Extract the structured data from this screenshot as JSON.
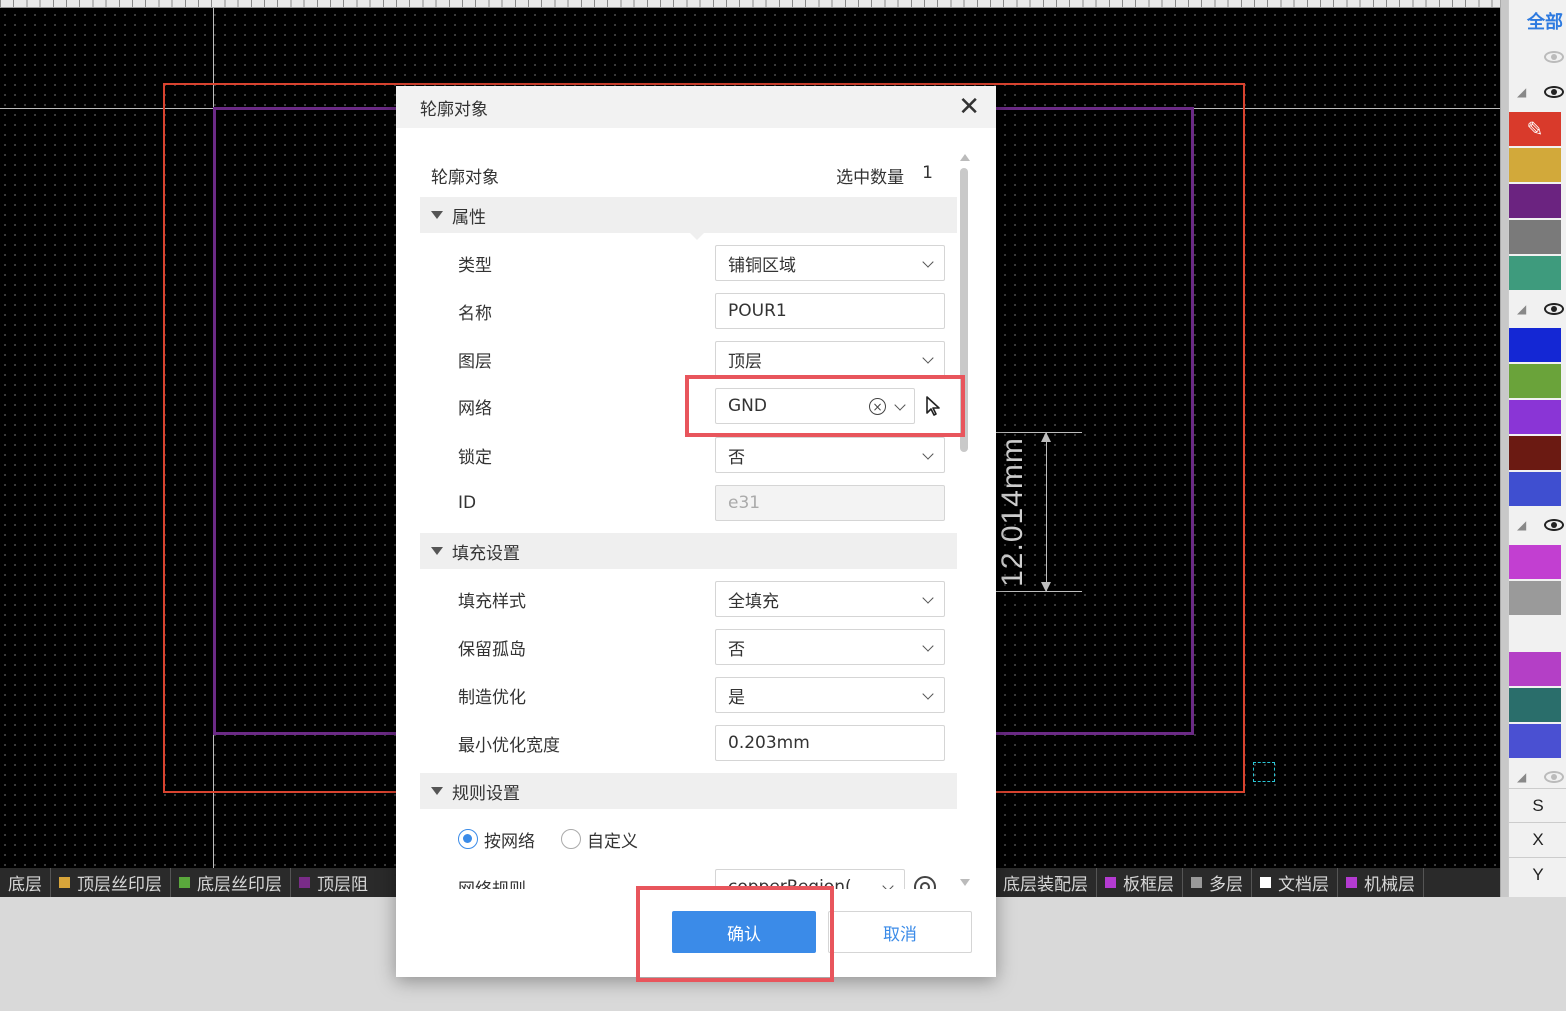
{
  "canvas": {
    "dimension_label": "12.014mm"
  },
  "layer_tabs": [
    {
      "label": "底层",
      "color": ""
    },
    {
      "label": "顶层丝印层",
      "color": "#d8a53a"
    },
    {
      "label": "底层丝印层",
      "color": "#5aa83c"
    },
    {
      "label": "顶层阻",
      "color": "#7a2c88"
    },
    {
      "label": "底层装配层",
      "color": "#3b4ad1"
    },
    {
      "label": "板框层",
      "color": "#b43bd1"
    },
    {
      "label": "多层",
      "color": "#9a9a9a"
    },
    {
      "label": "文档层",
      "color": "#ffffff"
    },
    {
      "label": "机械层",
      "color": "#b43bd1"
    }
  ],
  "right_panel": {
    "all_label": "全部",
    "swatches_group1": [
      "#d93a2b",
      "#d2a93a",
      "#6b2380",
      "#7a7a7a",
      "#3e9b7d"
    ],
    "swatches_group2": [
      "#1427d4",
      "#6aa33a",
      "#8a35d6",
      "#6b1a12",
      "#3f4fd0"
    ],
    "swatches_group3": [
      "#c23fd1",
      "#9a9a9a",
      "#f1f1f1",
      "#b43fc6",
      "#2a6e6b",
      "#4a50d2"
    ],
    "letters": [
      "S",
      "X",
      "Y"
    ]
  },
  "dialog": {
    "title": "轮廓对象",
    "close_icon": "close-icon",
    "object_label": "轮廓对象",
    "selected_count_label": "选中数量",
    "selected_count": "1",
    "sections": {
      "properties": "属性",
      "fill": "填充设置",
      "rules": "规则设置"
    },
    "properties": {
      "type": {
        "label": "类型",
        "value": "铺铜区域"
      },
      "name": {
        "label": "名称",
        "value": "POUR1"
      },
      "layer": {
        "label": "图层",
        "value": "顶层"
      },
      "net": {
        "label": "网络",
        "value": "GND"
      },
      "lock": {
        "label": "锁定",
        "value": "否"
      },
      "id": {
        "label": "ID",
        "value": "e31"
      }
    },
    "fill": {
      "style": {
        "label": "填充样式",
        "value": "全填充"
      },
      "keep_islands": {
        "label": "保留孤岛",
        "value": "否"
      },
      "manufacture_opt": {
        "label": "制造优化",
        "value": "是"
      },
      "min_width": {
        "label": "最小优化宽度",
        "value": "0.203mm"
      }
    },
    "rules": {
      "by_net": "按网络",
      "custom": "自定义",
      "selected": "按网络",
      "net_rule_label": "网络规则",
      "net_rule_value": "copperRegion("
    },
    "ok_label": "确认",
    "cancel_label": "取消"
  },
  "colors": {
    "accent": "#3b8be8",
    "highlight": "#e8555c",
    "board_outline": "#d9432f",
    "pour_outline": "#6b2a86"
  }
}
